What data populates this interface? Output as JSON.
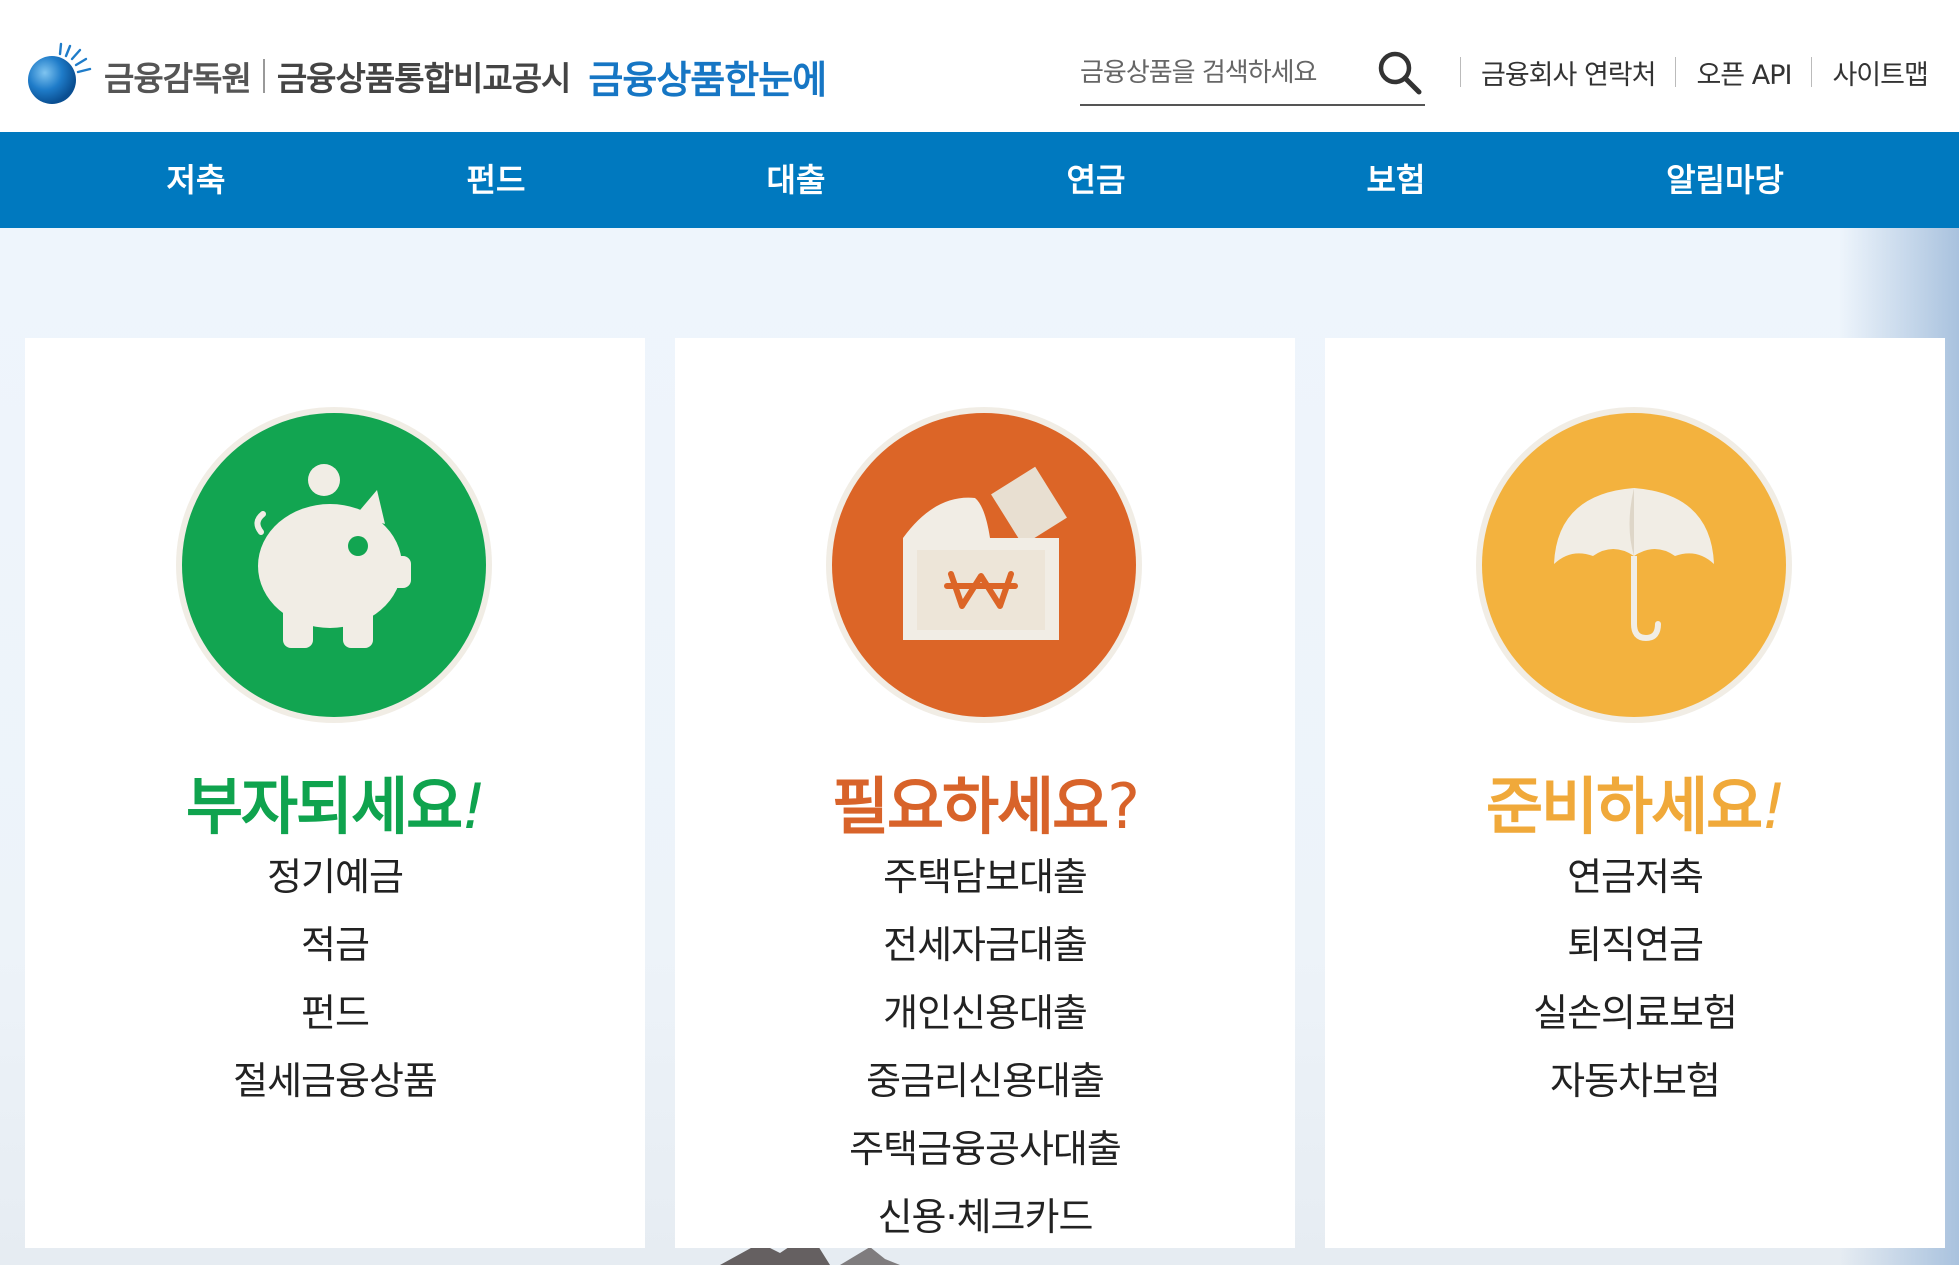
{
  "header": {
    "org_name": "금융감독원",
    "site_name": "금융상품통합비교공시",
    "brand_name": "금융상품한눈에",
    "search": {
      "placeholder": "금융상품을 검색하세요"
    },
    "util_links": [
      "금융회사 연락처",
      "오픈 API",
      "사이트맵"
    ]
  },
  "nav": {
    "items": [
      "저축",
      "펀드",
      "대출",
      "연금",
      "보험",
      "알림마당"
    ]
  },
  "cards": [
    {
      "title": "부자되세요",
      "punct": "!",
      "color": "#0fa34e",
      "circle_color": "#12a551",
      "icon": "piggy-bank-icon",
      "items": [
        "정기예금",
        "적금",
        "펀드",
        "절세금융상품"
      ]
    },
    {
      "title": "필요하세요",
      "punct": "?",
      "color": "#d8632a",
      "circle_color": "#dc6527",
      "icon": "won-envelope-icon",
      "items": [
        "주택담보대출",
        "전세자금대출",
        "개인신용대출",
        "중금리신용대출",
        "주택금융공사대출",
        "신용·체크카드"
      ]
    },
    {
      "title": "준비하세요",
      "punct": "!",
      "color": "#f0a93a",
      "circle_color": "#f3b23e",
      "icon": "umbrella-icon",
      "items": [
        "연금저축",
        "퇴직연금",
        "실손의료보험",
        "자동차보험"
      ]
    }
  ],
  "colors": {
    "nav_bg": "#0079bf",
    "brand_blue": "#1676c4"
  }
}
